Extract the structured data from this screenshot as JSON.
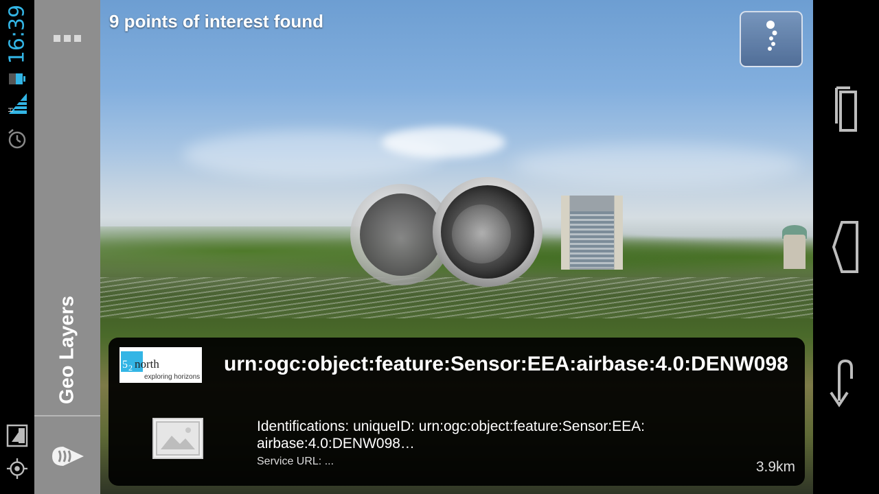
{
  "status_bar": {
    "time": "16:39",
    "icons": [
      "battery-icon",
      "signal-h-icon",
      "alarm-icon",
      "rotate-lock-icon",
      "gps-icon"
    ],
    "accent_color": "#33b5e5"
  },
  "side_panel": {
    "overflow_icon": "overflow-menu-icon",
    "geo_layers_label": "Geo Layers",
    "radar_icon": "radar-icon",
    "background_color": "#8e8e8e"
  },
  "camera_view": {
    "poi_count_text": "9 points of interest found",
    "radar_button_icon": "radar-dots-icon"
  },
  "poi_card": {
    "logo": {
      "brand_parts": [
        "52",
        "north"
      ],
      "tagline": "exploring horizons",
      "brand_color": "#33b5e5"
    },
    "title": "urn:ogc:object:feature:Sensor:EEA:airbase:4.0:DENW098",
    "thumbnail_icon": "image-placeholder-icon",
    "description": "Identifications: uniqueID: urn:ogc:object:feature:Sensor:EEA: airbase:4.0:DENW098…",
    "service_url": "Service URL: ...",
    "distance": "3.9km"
  },
  "nav_bar": {
    "buttons": [
      "recent-apps-button",
      "home-button",
      "back-button"
    ]
  }
}
